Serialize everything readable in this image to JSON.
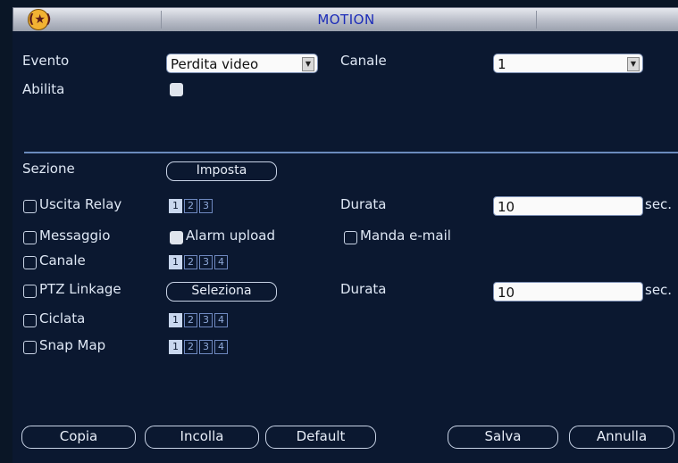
{
  "window": {
    "title": "MOTION",
    "logo_glyph": "(★)"
  },
  "event": {
    "label": "Evento",
    "value": "Perdita video"
  },
  "channel": {
    "label": "Canale",
    "value": "1"
  },
  "enable": {
    "label": "Abilita",
    "checked": true
  },
  "section": {
    "label": "Sezione",
    "button": "Imposta"
  },
  "relay": {
    "label": "Uscita Relay",
    "numbers": [
      "1",
      "2",
      "3"
    ],
    "active": "1"
  },
  "duration1": {
    "label": "Durata",
    "value": "10",
    "unit": "sec."
  },
  "message": {
    "label": "Messaggio"
  },
  "alarm_upload": {
    "label": "Alarm upload",
    "checked": true
  },
  "email": {
    "label": "Manda e-mail"
  },
  "channel_link": {
    "label": "Canale",
    "numbers": [
      "1",
      "2",
      "3",
      "4"
    ],
    "active": "1"
  },
  "ptz": {
    "label": "PTZ Linkage",
    "button": "Seleziona"
  },
  "duration2": {
    "label": "Durata",
    "value": "10",
    "unit": "sec."
  },
  "tour": {
    "label": "Ciclata",
    "numbers": [
      "1",
      "2",
      "3",
      "4"
    ],
    "active": "1"
  },
  "snap": {
    "label": "Snap Map",
    "numbers": [
      "1",
      "2",
      "3",
      "4"
    ],
    "active": "1"
  },
  "buttons": {
    "copy": "Copia",
    "paste": "Incolla",
    "default": "Default",
    "save": "Salva",
    "cancel": "Annulla"
  }
}
